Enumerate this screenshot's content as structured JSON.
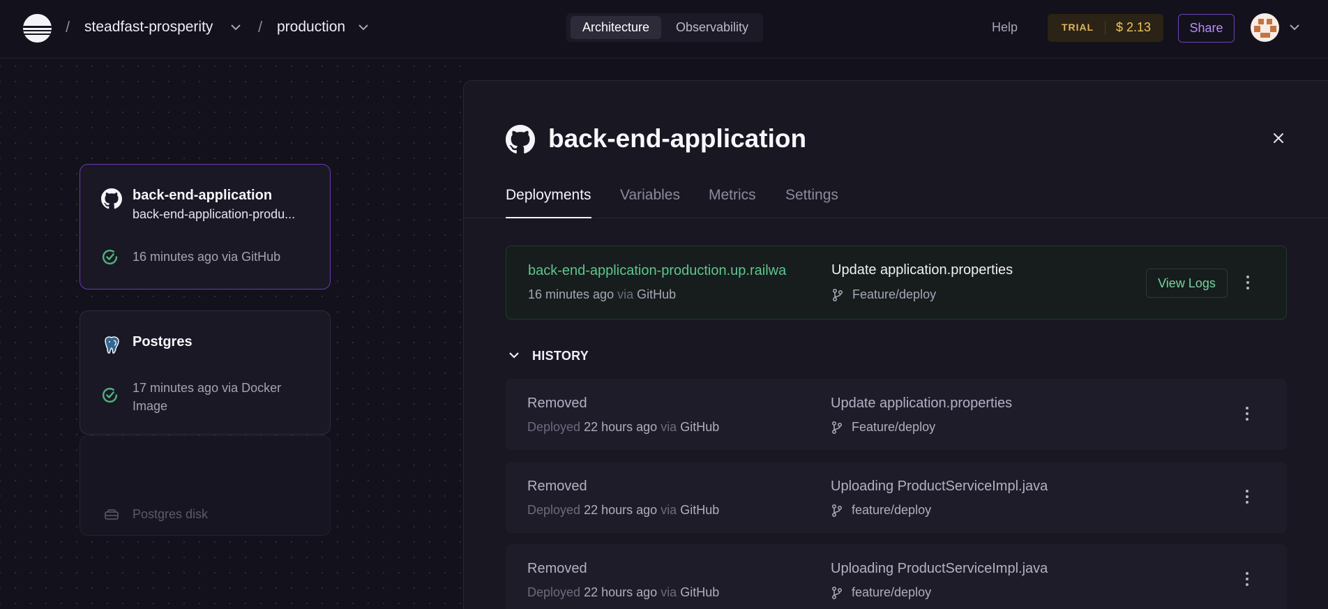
{
  "nav": {
    "project": "steadfast-prosperity",
    "environment": "production",
    "segments": [
      "Architecture",
      "Observability"
    ],
    "help": "Help",
    "trial_label": "TRIAL",
    "cost": "$ 2.13",
    "share": "Share"
  },
  "canvas": {
    "service_card": {
      "title": "back-end-application",
      "subtitle": "back-end-application-produ...",
      "status": "16 minutes ago via GitHub"
    },
    "db_card": {
      "title": "Postgres",
      "status": "17 minutes ago via Docker Image",
      "disk": "Postgres disk"
    }
  },
  "panel": {
    "title": "back-end-application",
    "tabs": [
      "Deployments",
      "Variables",
      "Metrics",
      "Settings"
    ],
    "active": {
      "url": "back-end-application-production.up.railwa",
      "time": "16 minutes ago",
      "via": "via",
      "source": "GitHub",
      "commit": "Update application.properties",
      "branch": "Feature/deploy",
      "view_logs": "View Logs"
    },
    "history_label": "HISTORY",
    "history": [
      {
        "status": "Removed",
        "deployed": "Deployed",
        "time": "22 hours ago",
        "via": "via",
        "source": "GitHub",
        "commit": "Update application.properties",
        "branch": "Feature/deploy"
      },
      {
        "status": "Removed",
        "deployed": "Deployed",
        "time": "22 hours ago",
        "via": "via",
        "source": "GitHub",
        "commit": "Uploading ProductServiceImpl.java",
        "branch": "feature/deploy"
      },
      {
        "status": "Removed",
        "deployed": "Deployed",
        "time": "22 hours ago",
        "via": "via",
        "source": "GitHub",
        "commit": "Uploading ProductServiceImpl.java",
        "branch": "feature/deploy"
      }
    ]
  }
}
